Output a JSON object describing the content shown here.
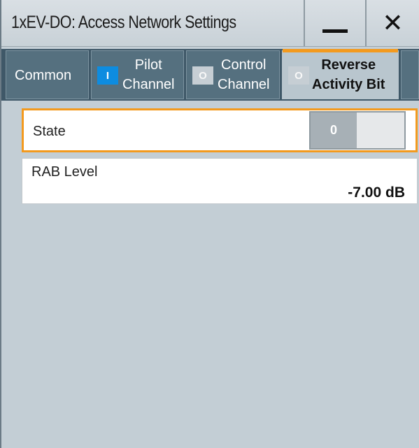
{
  "window": {
    "title": "1xEV-DO: Access Network Settings",
    "minimize_icon": "minimize-icon",
    "close_icon": "close-icon",
    "close_glyph": "✕"
  },
  "tabs": [
    {
      "label": "Common",
      "indicator": null,
      "active": false
    },
    {
      "line1": "Pilot",
      "line2": "Channel",
      "indicator": "I",
      "indicator_state": "on",
      "active": false
    },
    {
      "line1": "Control",
      "line2": "Channel",
      "indicator": "O",
      "indicator_state": "off",
      "active": false
    },
    {
      "line1": "Reverse",
      "line2": "Activity Bit",
      "indicator": "O",
      "indicator_state": "off",
      "active": true
    }
  ],
  "state": {
    "label": "State",
    "value": "0"
  },
  "rab_level": {
    "label": "RAB Level",
    "value": "-7.00 dB"
  },
  "colors": {
    "accent_orange": "#f39a1e",
    "indicator_on_blue": "#0d8ce0",
    "tabbar_dark": "#3f5868",
    "background": "#c3ced5"
  }
}
